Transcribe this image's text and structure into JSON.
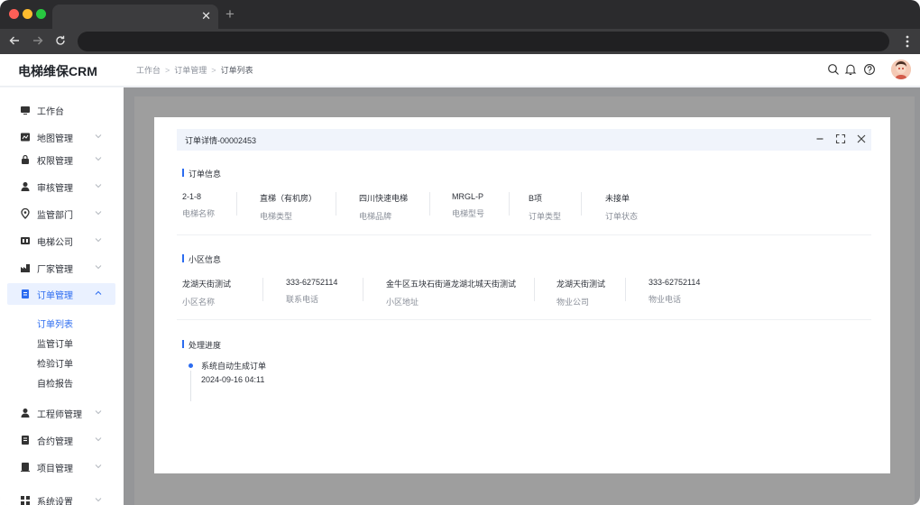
{
  "app": {
    "title": "电梯维保CRM"
  },
  "browser": {
    "tab_close": "✕",
    "new_tab": "+"
  },
  "breadcrumb": {
    "items": [
      "工作台",
      "订单管理",
      "订单列表"
    ],
    "separator": ">"
  },
  "sidebar": {
    "items": [
      {
        "label": "工作台",
        "icon": "monitor-icon"
      },
      {
        "label": "地图管理",
        "icon": "map-icon"
      },
      {
        "label": "权限管理",
        "icon": "lock-icon"
      },
      {
        "label": "审核管理",
        "icon": "user-check-icon"
      },
      {
        "label": "监管部门",
        "icon": "location-pin-icon"
      },
      {
        "label": "电梯公司",
        "icon": "elevator-icon"
      },
      {
        "label": "厂家管理",
        "icon": "factory-icon"
      },
      {
        "label": "订单管理",
        "icon": "order-icon"
      },
      {
        "label": "工程师管理",
        "icon": "engineer-icon"
      },
      {
        "label": "合约管理",
        "icon": "contract-icon"
      },
      {
        "label": "项目管理",
        "icon": "project-icon"
      },
      {
        "label": "系统设置",
        "icon": "settings-icon"
      }
    ],
    "sub_items": [
      "订单列表",
      "监管订单",
      "检验订单",
      "自检报告"
    ],
    "active_item": "订单管理",
    "active_sub": "订单列表"
  },
  "modal": {
    "title": "订单详情-00002453",
    "sections": {
      "order": {
        "title": "订单信息",
        "fields": [
          {
            "value": "2-1-8",
            "label": "电梯名称"
          },
          {
            "value": "直梯（有机房）",
            "label": "电梯类型"
          },
          {
            "value": "四川快速电梯",
            "label": "电梯品牌"
          },
          {
            "value": "MRGL-P",
            "label": "电梯型号"
          },
          {
            "value": "B项",
            "label": "订单类型"
          },
          {
            "value": "未接单",
            "label": "订单状态"
          }
        ]
      },
      "community": {
        "title": "小区信息",
        "fields": [
          {
            "value": "龙湖天街测试",
            "label": "小区名称"
          },
          {
            "value": "333-62752114",
            "label": "联系电话"
          },
          {
            "value": "金牛区五块石街道龙湖北城天街测试",
            "label": "小区地址"
          },
          {
            "value": "龙湖天街测试",
            "label": "物业公司"
          },
          {
            "value": "333-62752114",
            "label": "物业电话"
          }
        ]
      },
      "progress": {
        "title": "处理进度",
        "events": [
          {
            "text": "系统自动生成订单",
            "time": "2024-09-16  04:11"
          }
        ]
      }
    }
  },
  "colors": {
    "accent": "#2c6cf0",
    "overlay": "#000000"
  }
}
